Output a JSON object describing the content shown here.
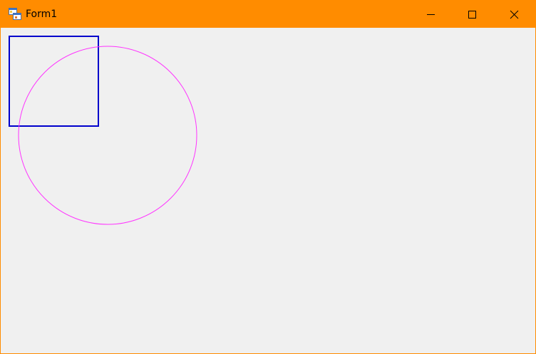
{
  "window": {
    "title": "Form1",
    "accent_color": "#ff8c00",
    "client_background": "#f0f0f0",
    "icon": "winforms-app-icon"
  },
  "caption_buttons": {
    "minimize_icon": "minimize-icon",
    "maximize_icon": "maximize-icon",
    "close_icon": "close-icon"
  },
  "drawing": {
    "rectangle_color": "#0000cc",
    "circle_color": "#ff33ff"
  }
}
